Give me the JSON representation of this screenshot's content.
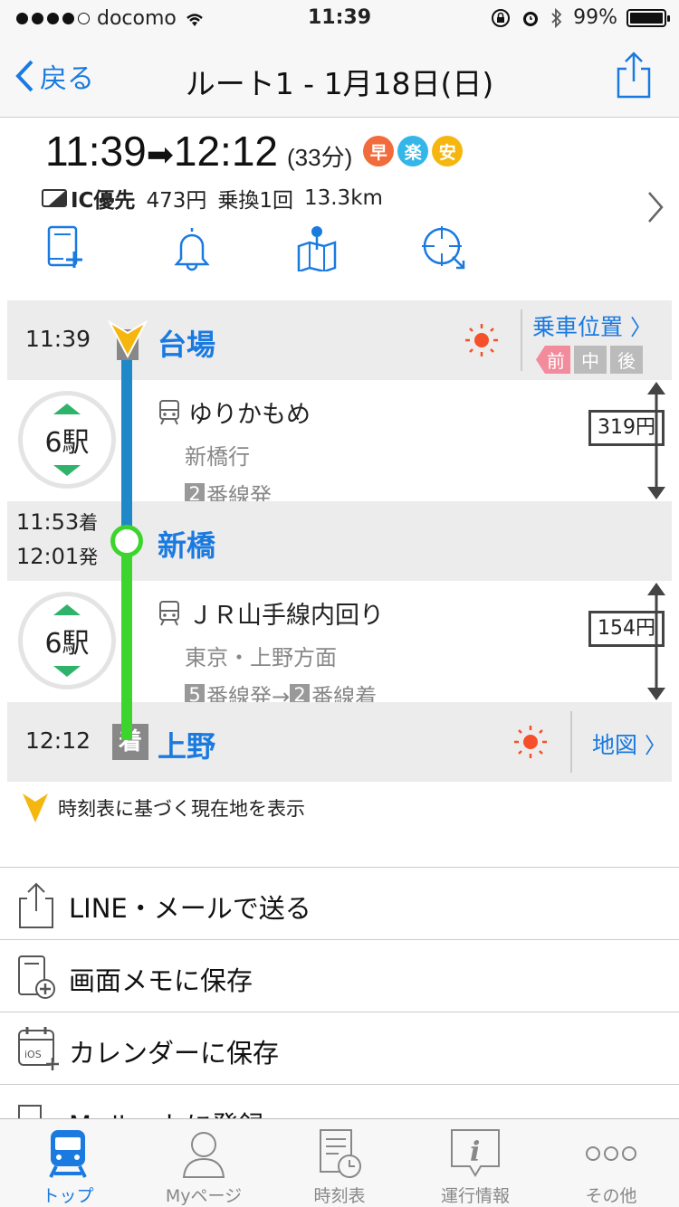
{
  "status": {
    "carrier": "docomo",
    "time": "11:39",
    "battery": "99%"
  },
  "nav": {
    "back": "戻る",
    "title": "ルート1 - 1月18日(日)"
  },
  "summary": {
    "depart": "11:39",
    "arrive": "12:12",
    "duration": "(33分)",
    "badges": [
      {
        "label": "早",
        "color": "#f26b3a"
      },
      {
        "label": "楽",
        "color": "#35b6e8"
      },
      {
        "label": "安",
        "color": "#f5b70f"
      }
    ],
    "ic_label": "IC優先",
    "fare": "473円",
    "transfer": "乗換1回",
    "distance": "13.3km"
  },
  "route": {
    "origin": {
      "time": "11:39",
      "name": "台場",
      "board_label": "乗車位置",
      "pos": [
        "前",
        "中",
        "後"
      ]
    },
    "seg1": {
      "count": "6駅",
      "line": "ゆりかもめ",
      "dest": "新橋行",
      "platform_num": "2",
      "platform_text": "番線発",
      "fare": "319円",
      "color": "#1e88c9"
    },
    "transfer": {
      "arr": "11:53",
      "arr_label": "着",
      "dep": "12:01",
      "dep_label": "発",
      "name": "新橋"
    },
    "seg2": {
      "count": "6駅",
      "line": "ＪＲ山手線内回り",
      "dest": "東京・上野方面",
      "platform_from": "5",
      "platform_from_text": "番線発→",
      "platform_to": "2",
      "platform_to_text": "番線着",
      "fare": "154円",
      "color": "#3ed42e"
    },
    "dest": {
      "time": "12:12",
      "mark": "着",
      "name": "上野",
      "map_label": "地図"
    }
  },
  "note": "時刻表に基づく現在地を表示",
  "menu": [
    {
      "label": "LINE・メールで送る",
      "icon": "share-icon"
    },
    {
      "label": "画面メモに保存",
      "icon": "memo-add-icon"
    },
    {
      "label": "カレンダーに保存",
      "icon": "calendar-add-icon"
    },
    {
      "label": "Myルートに登録",
      "icon": "checkbox-icon"
    }
  ],
  "tabs": [
    {
      "label": "トップ",
      "icon": "train-icon",
      "active": true
    },
    {
      "label": "Myページ",
      "icon": "person-icon",
      "active": false
    },
    {
      "label": "時刻表",
      "icon": "timetable-icon",
      "active": false
    },
    {
      "label": "運行情報",
      "icon": "info-icon",
      "active": false
    },
    {
      "label": "その他",
      "icon": "more-icon",
      "active": false
    }
  ],
  "colors": {
    "accent": "#1a7ae0",
    "orange": "#f26b3a",
    "yellow": "#f5b70f"
  }
}
